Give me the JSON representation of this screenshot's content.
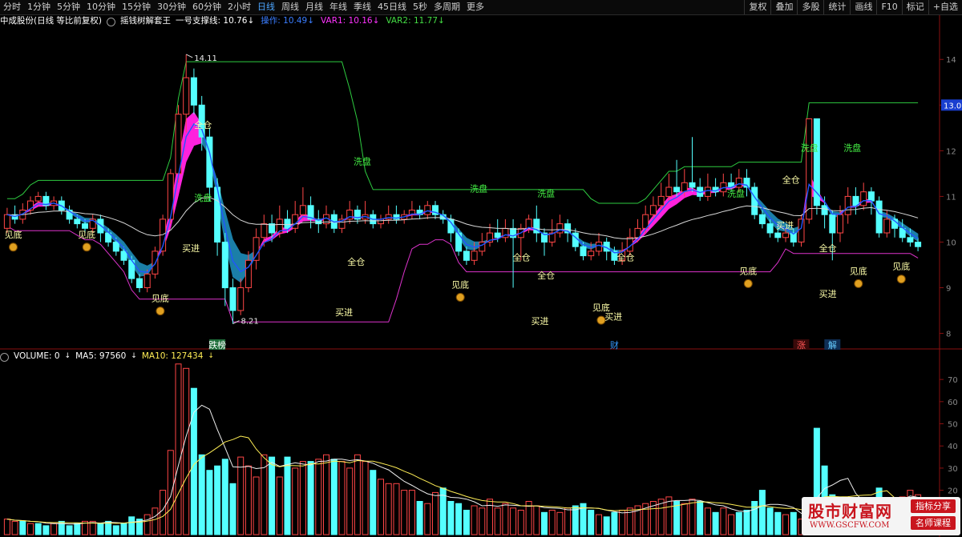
{
  "toolbar": {
    "periods": [
      "分时",
      "1分钟",
      "5分钟",
      "10分钟",
      "15分钟",
      "30分钟",
      "60分钟",
      "2小时",
      "日线",
      "周线",
      "月线",
      "年线",
      "季线",
      "45日线",
      "5秒",
      "多周期",
      "更多"
    ],
    "active_index": 8,
    "right_items": [
      "复权",
      "叠加",
      "多股",
      "统计",
      "画线",
      "F10",
      "标记",
      "+自选"
    ]
  },
  "info": {
    "stock": "中成股份(日线 等比前复权)",
    "indicator": "摇钱树解套王",
    "items": [
      {
        "label": "一号支撑线: 10.76",
        "color": "#ffffff"
      },
      {
        "label": "操作: 10.49",
        "color": "#3a7dff"
      },
      {
        "label": "VAR1: 10.16",
        "color": "#ff33ff"
      },
      {
        "label": "VAR2: 11.77",
        "color": "#44dd44"
      }
    ]
  },
  "volume_info": {
    "label": "VOLUME: 0",
    "ma5": "MA5: 97560",
    "ma10": "MA10: 127434"
  },
  "colors": {
    "up": "#ff4646",
    "down": "#54ffff",
    "ma_white": "#d8d8d8",
    "support_green": "#2ecc40",
    "var1_magenta": "#dd33cc",
    "band_pink": "#ff22dd",
    "band_blue": "#1b7fa8",
    "operate_blue": "#2255ff"
  },
  "chart_data": {
    "type": "candlestick",
    "n_days": 118,
    "yaxis_price": {
      "ticks": [
        14,
        13,
        12,
        11,
        10,
        9,
        8
      ],
      "ylim": [
        7.8,
        14.6
      ],
      "current_label": "13.0"
    },
    "yaxis_volume": {
      "ticks": [
        "70",
        "60",
        "50",
        "40",
        "30",
        "20"
      ],
      "ylim": [
        0,
        78
      ]
    },
    "price_high_label": "14.11",
    "price_low_label": "8.21",
    "x_axis_marks": [
      {
        "i": 27,
        "text": "跌榜",
        "bg": "#1e6e3a",
        "color": "#ffffff"
      },
      {
        "i": 78,
        "text": "财",
        "bg": "",
        "color": "#3399ff"
      },
      {
        "i": 102,
        "text": "涨",
        "bg": "#3a0a0a",
        "color": "#ff5555"
      },
      {
        "i": 106,
        "text": "解",
        "bg": "#0f2e55",
        "color": "#66ccff"
      }
    ],
    "candles": [
      [
        10.3,
        10.6,
        10.75,
        10.2
      ],
      [
        10.6,
        10.5,
        10.8,
        10.4
      ],
      [
        10.5,
        10.7,
        10.85,
        10.4
      ],
      [
        10.7,
        10.9,
        11.0,
        10.6
      ],
      [
        10.9,
        11.0,
        11.1,
        10.8
      ],
      [
        11.0,
        10.8,
        11.1,
        10.7
      ],
      [
        10.8,
        10.9,
        11.0,
        10.7
      ],
      [
        10.9,
        10.7,
        11.0,
        10.6
      ],
      [
        10.7,
        10.5,
        10.8,
        10.4
      ],
      [
        10.5,
        10.4,
        10.6,
        10.3
      ],
      [
        10.4,
        10.3,
        10.5,
        10.2
      ],
      [
        10.3,
        10.5,
        10.6,
        10.2
      ],
      [
        10.5,
        10.2,
        10.6,
        10.0
      ],
      [
        10.2,
        10.0,
        10.3,
        9.9
      ],
      [
        10.0,
        9.8,
        10.1,
        9.7
      ],
      [
        9.8,
        9.6,
        9.9,
        9.5
      ],
      [
        9.6,
        9.2,
        9.7,
        9.1
      ],
      [
        9.2,
        9.0,
        9.3,
        8.9
      ],
      [
        9.0,
        9.3,
        9.4,
        8.9
      ],
      [
        9.3,
        9.8,
        9.9,
        9.2
      ],
      [
        9.8,
        10.5,
        10.6,
        9.7
      ],
      [
        10.5,
        11.5,
        11.6,
        10.4
      ],
      [
        11.5,
        12.8,
        13.0,
        11.3
      ],
      [
        12.8,
        13.6,
        14.11,
        12.4
      ],
      [
        13.6,
        13.0,
        13.8,
        12.8
      ],
      [
        13.0,
        12.3,
        13.2,
        12.0
      ],
      [
        12.3,
        11.2,
        12.5,
        10.9
      ],
      [
        11.2,
        10.0,
        11.4,
        9.7
      ],
      [
        10.0,
        9.0,
        10.2,
        8.6
      ],
      [
        9.0,
        8.5,
        9.2,
        8.21
      ],
      [
        8.5,
        9.0,
        9.2,
        8.4
      ],
      [
        9.0,
        9.6,
        9.8,
        8.9
      ],
      [
        9.6,
        10.1,
        10.3,
        9.4
      ],
      [
        10.1,
        10.4,
        10.6,
        9.9
      ],
      [
        10.4,
        10.2,
        10.6,
        10.0
      ],
      [
        10.2,
        10.5,
        10.8,
        10.1
      ],
      [
        10.5,
        10.3,
        10.7,
        10.2
      ],
      [
        10.3,
        10.6,
        10.9,
        10.2
      ],
      [
        10.6,
        10.8,
        11.2,
        10.5
      ],
      [
        10.8,
        10.5,
        11.0,
        10.3
      ],
      [
        10.5,
        10.4,
        10.7,
        10.2
      ],
      [
        10.4,
        10.6,
        10.8,
        10.3
      ],
      [
        10.6,
        10.3,
        10.7,
        10.2
      ],
      [
        10.3,
        10.5,
        10.6,
        10.2
      ],
      [
        10.5,
        10.7,
        10.9,
        10.4
      ],
      [
        10.7,
        10.5,
        10.8,
        10.4
      ],
      [
        10.5,
        10.6,
        10.9,
        10.4
      ],
      [
        10.6,
        10.4,
        10.7,
        10.3
      ],
      [
        10.4,
        10.5,
        10.6,
        10.3
      ],
      [
        10.5,
        10.6,
        10.8,
        10.4
      ],
      [
        10.6,
        10.5,
        10.8,
        10.4
      ],
      [
        10.5,
        10.6,
        10.7,
        10.4
      ],
      [
        10.6,
        10.7,
        10.9,
        10.5
      ],
      [
        10.7,
        10.6,
        10.8,
        10.5
      ],
      [
        10.6,
        10.8,
        10.9,
        10.5
      ],
      [
        10.8,
        10.6,
        10.9,
        10.5
      ],
      [
        10.6,
        10.5,
        10.7,
        10.4
      ],
      [
        10.5,
        10.2,
        10.6,
        10.0
      ],
      [
        10.2,
        9.8,
        10.3,
        9.7
      ],
      [
        9.8,
        9.6,
        9.9,
        9.5
      ],
      [
        9.6,
        9.8,
        10.0,
        9.5
      ],
      [
        9.8,
        10.0,
        10.2,
        9.7
      ],
      [
        10.0,
        10.2,
        10.4,
        9.9
      ],
      [
        10.2,
        10.1,
        10.5,
        10.0
      ],
      [
        10.1,
        10.3,
        10.5,
        10.0
      ],
      [
        10.3,
        10.1,
        10.5,
        9.0
      ],
      [
        10.1,
        10.3,
        10.4,
        9.6
      ],
      [
        10.3,
        10.5,
        10.6,
        10.2
      ],
      [
        10.5,
        10.2,
        10.8,
        10.0
      ],
      [
        10.2,
        10.0,
        10.3,
        9.7
      ],
      [
        10.0,
        10.2,
        10.5,
        9.9
      ],
      [
        10.2,
        10.4,
        10.6,
        10.1
      ],
      [
        10.4,
        10.2,
        10.5,
        10.0
      ],
      [
        10.2,
        9.9,
        10.3,
        9.8
      ],
      [
        9.9,
        9.7,
        10.0,
        9.6
      ],
      [
        9.7,
        9.8,
        10.0,
        9.6
      ],
      [
        9.8,
        10.0,
        10.2,
        9.7
      ],
      [
        10.0,
        9.8,
        10.1,
        9.6
      ],
      [
        9.8,
        9.6,
        9.9,
        9.5
      ],
      [
        9.6,
        9.8,
        10.0,
        9.5
      ],
      [
        9.8,
        10.1,
        10.3,
        9.7
      ],
      [
        10.1,
        10.3,
        10.5,
        10.0
      ],
      [
        10.3,
        10.6,
        10.8,
        10.2
      ],
      [
        10.6,
        10.8,
        11.0,
        10.5
      ],
      [
        10.8,
        11.0,
        11.3,
        10.7
      ],
      [
        11.0,
        11.2,
        11.5,
        10.9
      ],
      [
        11.2,
        11.1,
        11.8,
        11.0
      ],
      [
        11.1,
        11.3,
        11.6,
        11.0
      ],
      [
        11.3,
        11.2,
        12.3,
        11.1
      ],
      [
        11.2,
        11.0,
        11.4,
        10.9
      ],
      [
        11.0,
        11.2,
        11.5,
        10.9
      ],
      [
        11.2,
        11.1,
        11.4,
        11.0
      ],
      [
        11.1,
        11.3,
        11.5,
        11.0
      ],
      [
        11.3,
        11.2,
        11.5,
        11.1
      ],
      [
        11.2,
        11.4,
        11.6,
        11.1
      ],
      [
        11.4,
        11.2,
        11.6,
        11.0
      ],
      [
        11.2,
        10.6,
        11.3,
        10.5
      ],
      [
        10.6,
        10.4,
        10.7,
        10.3
      ],
      [
        10.4,
        10.2,
        10.5,
        10.1
      ],
      [
        10.2,
        10.1,
        10.4,
        10.0
      ],
      [
        10.1,
        10.2,
        10.3,
        10.0
      ],
      [
        10.2,
        10.0,
        10.3,
        9.9
      ],
      [
        10.0,
        10.5,
        10.6,
        9.9
      ],
      [
        10.5,
        12.7,
        12.7,
        10.4
      ],
      [
        12.7,
        10.8,
        12.7,
        10.6
      ],
      [
        10.8,
        10.6,
        11.0,
        10.3
      ],
      [
        10.6,
        10.2,
        10.7,
        9.6
      ],
      [
        10.2,
        10.6,
        10.8,
        10.0
      ],
      [
        10.6,
        11.0,
        11.2,
        10.4
      ],
      [
        11.0,
        10.8,
        11.2,
        10.6
      ],
      [
        10.8,
        11.1,
        11.3,
        10.7
      ],
      [
        11.1,
        10.9,
        11.2,
        10.6
      ],
      [
        10.9,
        10.2,
        11.0,
        10.1
      ],
      [
        10.2,
        10.5,
        10.7,
        10.1
      ],
      [
        10.5,
        10.3,
        10.6,
        10.1
      ],
      [
        10.3,
        10.1,
        10.5,
        10.0
      ],
      [
        10.1,
        10.0,
        10.3,
        9.9
      ],
      [
        10.0,
        9.9,
        10.1,
        9.8
      ]
    ],
    "volumes": [
      [
        7,
        0
      ],
      [
        6,
        0
      ],
      [
        6,
        1
      ],
      [
        5,
        0
      ],
      [
        5,
        1
      ],
      [
        4,
        1
      ],
      [
        5,
        0
      ],
      [
        6,
        1
      ],
      [
        4,
        1
      ],
      [
        5,
        1
      ],
      [
        6,
        0
      ],
      [
        6,
        0
      ],
      [
        5,
        1
      ],
      [
        6,
        1
      ],
      [
        4,
        1
      ],
      [
        5,
        1
      ],
      [
        8,
        1
      ],
      [
        7,
        1
      ],
      [
        9,
        0
      ],
      [
        12,
        0
      ],
      [
        20,
        0
      ],
      [
        38,
        0
      ],
      [
        77,
        0
      ],
      [
        75,
        0
      ],
      [
        66,
        1
      ],
      [
        36,
        1
      ],
      [
        29,
        1
      ],
      [
        31,
        1
      ],
      [
        34,
        1
      ],
      [
        23,
        1
      ],
      [
        35,
        0
      ],
      [
        31,
        0
      ],
      [
        26,
        0
      ],
      [
        36,
        0
      ],
      [
        35,
        1
      ],
      [
        26,
        0
      ],
      [
        35,
        1
      ],
      [
        30,
        0
      ],
      [
        33,
        0
      ],
      [
        33,
        1
      ],
      [
        34,
        0
      ],
      [
        36,
        0
      ],
      [
        34,
        1
      ],
      [
        33,
        0
      ],
      [
        30,
        0
      ],
      [
        36,
        0
      ],
      [
        33,
        0
      ],
      [
        29,
        1
      ],
      [
        25,
        0
      ],
      [
        23,
        0
      ],
      [
        23,
        0
      ],
      [
        20,
        0
      ],
      [
        20,
        0
      ],
      [
        15,
        1
      ],
      [
        14,
        0
      ],
      [
        19,
        0
      ],
      [
        21,
        1
      ],
      [
        15,
        1
      ],
      [
        14,
        1
      ],
      [
        11,
        1
      ],
      [
        13,
        0
      ],
      [
        12,
        0
      ],
      [
        16,
        0
      ],
      [
        12,
        0
      ],
      [
        14,
        0
      ],
      [
        12,
        0
      ],
      [
        11,
        0
      ],
      [
        15,
        0
      ],
      [
        13,
        0
      ],
      [
        10,
        1
      ],
      [
        11,
        0
      ],
      [
        10,
        0
      ],
      [
        12,
        0
      ],
      [
        13,
        1
      ],
      [
        14,
        1
      ],
      [
        11,
        1
      ],
      [
        9,
        0
      ],
      [
        8,
        1
      ],
      [
        10,
        1
      ],
      [
        11,
        0
      ],
      [
        12,
        0
      ],
      [
        13,
        0
      ],
      [
        14,
        0
      ],
      [
        15,
        0
      ],
      [
        16,
        0
      ],
      [
        17,
        0
      ],
      [
        15,
        1
      ],
      [
        14,
        0
      ],
      [
        16,
        0
      ],
      [
        15,
        1
      ],
      [
        12,
        0
      ],
      [
        10,
        1
      ],
      [
        12,
        0
      ],
      [
        9,
        0
      ],
      [
        10,
        1
      ],
      [
        11,
        1
      ],
      [
        15,
        1
      ],
      [
        20,
        1
      ],
      [
        12,
        1
      ],
      [
        10,
        1
      ],
      [
        9,
        0
      ],
      [
        10,
        1
      ],
      [
        7,
        0
      ],
      [
        8,
        0
      ],
      [
        48,
        1
      ],
      [
        31,
        1
      ],
      [
        18,
        1
      ],
      [
        17,
        1
      ],
      [
        13,
        0
      ],
      [
        14,
        0
      ],
      [
        12,
        0
      ],
      [
        11,
        1
      ],
      [
        21,
        1
      ],
      [
        13,
        0
      ],
      [
        16,
        0
      ],
      [
        17,
        0
      ],
      [
        20,
        0
      ],
      [
        18,
        0
      ]
    ],
    "annotations": [
      {
        "text": "见底",
        "i": 1,
        "price": 10.1,
        "color": "#ffffaa",
        "icon": true
      },
      {
        "text": "见底",
        "i": 13,
        "price": 10.1,
        "color": "#ffffaa",
        "icon": true
      },
      {
        "text": "见底",
        "i": 25,
        "price": 8.7,
        "color": "#ffffaa",
        "icon": true
      },
      {
        "text": "买进",
        "i": 30,
        "price": 9.8,
        "color": "#ffffaa",
        "icon": false
      },
      {
        "text": "全仓",
        "i": 32,
        "price": 12.5,
        "color": "#ffffaa",
        "icon": false
      },
      {
        "text": "洗盘",
        "i": 32,
        "price": 10.9,
        "color": "#44ee44",
        "icon": false
      },
      {
        "text": "洗盘",
        "i": 58,
        "price": 11.7,
        "color": "#44ee44",
        "icon": false
      },
      {
        "text": "全仓",
        "i": 57,
        "price": 9.5,
        "color": "#ffffaa",
        "icon": false
      },
      {
        "text": "买进",
        "i": 55,
        "price": 8.4,
        "color": "#ffffaa",
        "icon": false
      },
      {
        "text": "见底",
        "i": 74,
        "price": 9.0,
        "color": "#ffffaa",
        "icon": true
      },
      {
        "text": "洗盘",
        "i": 77,
        "price": 11.1,
        "color": "#44ee44",
        "icon": false
      },
      {
        "text": "洗盘",
        "i": 88,
        "price": 11.0,
        "color": "#44ee44",
        "icon": false
      },
      {
        "text": "全仓",
        "i": 84,
        "price": 9.6,
        "color": "#ffffaa",
        "icon": false
      },
      {
        "text": "全仓",
        "i": 88,
        "price": 9.2,
        "color": "#ffffaa",
        "icon": false
      },
      {
        "text": "买进",
        "i": 87,
        "price": 8.2,
        "color": "#ffffaa",
        "icon": false
      },
      {
        "text": "见底",
        "i": 97,
        "price": 8.5,
        "color": "#ffffaa",
        "icon": true
      },
      {
        "text": "全仓",
        "i": 101,
        "price": 9.6,
        "color": "#ffffaa",
        "icon": false
      },
      {
        "text": "买进",
        "i": 99,
        "price": 8.3,
        "color": "#ffffaa",
        "icon": false
      },
      {
        "text": "洗盘",
        "i": 119,
        "price": 11.0,
        "color": "#44ee44",
        "icon": false
      },
      {
        "text": "见底",
        "i": 121,
        "price": 9.3,
        "color": "#ffffaa",
        "icon": true
      },
      {
        "text": "全仓",
        "i": 128,
        "price": 11.3,
        "color": "#ffffaa",
        "icon": false
      },
      {
        "text": "洗盘",
        "i": 131,
        "price": 12.0,
        "color": "#44ee44",
        "icon": false
      },
      {
        "text": "洗盘",
        "i": 138,
        "price": 12.0,
        "color": "#44ee44",
        "icon": false
      },
      {
        "text": "买进",
        "i": 127,
        "price": 10.3,
        "color": "#ffffaa",
        "icon": false
      },
      {
        "text": "全仓",
        "i": 134,
        "price": 9.8,
        "color": "#ffffaa",
        "icon": false
      },
      {
        "text": "见底",
        "i": 139,
        "price": 9.3,
        "color": "#ffffaa",
        "icon": true
      },
      {
        "text": "买进",
        "i": 134,
        "price": 8.8,
        "color": "#ffffaa",
        "icon": false
      },
      {
        "text": "见底",
        "i": 146,
        "price": 9.4,
        "color": "#ffffaa",
        "icon": true
      }
    ]
  },
  "logo": {
    "main": "股市财富网",
    "url": "WWW.GSCFW.COM",
    "badge1": "指标分享",
    "badge2": "名师课程"
  }
}
